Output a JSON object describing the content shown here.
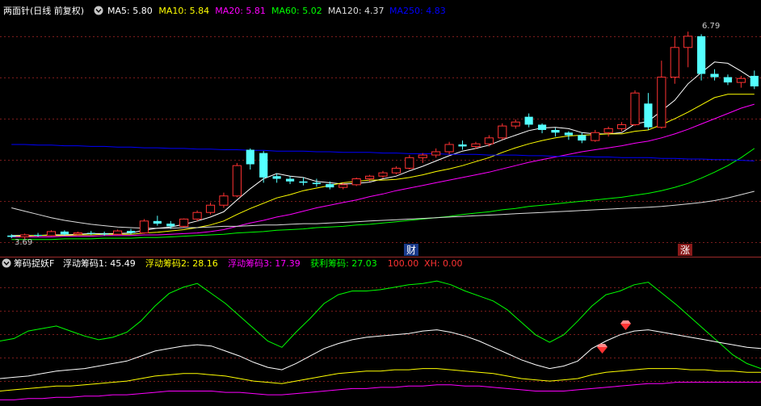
{
  "top_panel": {
    "title": "两面针(日线 前复权)",
    "ma_labels": [
      {
        "text": "MA5: 5.80",
        "color": "#ffffff"
      },
      {
        "text": "MA10: 5.84",
        "color": "#ffff00"
      },
      {
        "text": "MA20: 5.81",
        "color": "#ff00ff"
      },
      {
        "text": "MA60: 5.02",
        "color": "#00ff00"
      },
      {
        "text": "MA120: 4.37",
        "color": "#dddddd"
      },
      {
        "text": "MA250: 4.83",
        "color": "#0000ff"
      }
    ],
    "high_label": "6.79",
    "low_label": "3.69",
    "markers": [
      "财",
      "涨"
    ]
  },
  "bottom_panel": {
    "title": "筹码捉妖F",
    "labels": [
      {
        "text": "浮动筹码1: 45.49",
        "color": "#ffffff"
      },
      {
        "text": "浮动筹码2: 28.16",
        "color": "#ffff00"
      },
      {
        "text": "浮动筹码3: 17.39",
        "color": "#ff00ff"
      },
      {
        "text": "获利筹码: 27.03",
        "color": "#00ff00"
      },
      {
        "text": "100.00",
        "color": "#ff3333"
      },
      {
        "text": "XH: 0.00",
        "color": "#ff3333"
      }
    ]
  },
  "chart_data": [
    {
      "type": "candlestick",
      "title": "两面针(日线 前复权)",
      "ylim": [
        3.6,
        7.0
      ],
      "log_scale": false,
      "up_color": "#ff3232",
      "down_color": "#54ffff",
      "candles": [
        [
          3.7,
          3.72,
          3.66,
          3.68
        ],
        [
          3.68,
          3.73,
          3.65,
          3.71
        ],
        [
          3.71,
          3.74,
          3.68,
          3.7
        ],
        [
          3.7,
          3.78,
          3.69,
          3.76
        ],
        [
          3.76,
          3.78,
          3.7,
          3.72
        ],
        [
          3.72,
          3.76,
          3.7,
          3.74
        ],
        [
          3.74,
          3.77,
          3.71,
          3.73
        ],
        [
          3.73,
          3.76,
          3.7,
          3.72
        ],
        [
          3.72,
          3.79,
          3.71,
          3.77
        ],
        [
          3.77,
          3.8,
          3.72,
          3.74
        ],
        [
          3.74,
          3.95,
          3.73,
          3.92
        ],
        [
          3.92,
          4.0,
          3.85,
          3.88
        ],
        [
          3.88,
          3.92,
          3.8,
          3.84
        ],
        [
          3.84,
          3.96,
          3.82,
          3.95
        ],
        [
          3.95,
          4.08,
          3.92,
          4.05
        ],
        [
          4.05,
          4.2,
          4.02,
          4.16
        ],
        [
          4.16,
          4.35,
          4.12,
          4.3
        ],
        [
          4.3,
          4.8,
          4.28,
          4.76
        ],
        [
          5.0,
          5.02,
          4.7,
          4.78
        ],
        [
          4.95,
          4.98,
          4.5,
          4.58
        ],
        [
          4.6,
          4.64,
          4.5,
          4.56
        ],
        [
          4.56,
          4.6,
          4.48,
          4.52
        ],
        [
          4.52,
          4.58,
          4.46,
          4.5
        ],
        [
          4.5,
          4.56,
          4.44,
          4.48
        ],
        [
          4.48,
          4.52,
          4.4,
          4.43
        ],
        [
          4.43,
          4.5,
          4.4,
          4.47
        ],
        [
          4.47,
          4.58,
          4.45,
          4.56
        ],
        [
          4.56,
          4.62,
          4.52,
          4.6
        ],
        [
          4.6,
          4.68,
          4.57,
          4.65
        ],
        [
          4.65,
          4.75,
          4.63,
          4.72
        ],
        [
          4.72,
          4.92,
          4.7,
          4.88
        ],
        [
          4.88,
          4.95,
          4.8,
          4.92
        ],
        [
          4.92,
          5.02,
          4.88,
          4.97
        ],
        [
          4.97,
          5.12,
          4.93,
          5.08
        ],
        [
          5.08,
          5.14,
          5.0,
          5.05
        ],
        [
          5.05,
          5.12,
          5.01,
          5.09
        ],
        [
          5.09,
          5.22,
          5.05,
          5.18
        ],
        [
          5.18,
          5.4,
          5.15,
          5.36
        ],
        [
          5.36,
          5.46,
          5.32,
          5.42
        ],
        [
          5.5,
          5.55,
          5.34,
          5.38
        ],
        [
          5.38,
          5.4,
          5.25,
          5.3
        ],
        [
          5.3,
          5.33,
          5.2,
          5.26
        ],
        [
          5.26,
          5.28,
          5.15,
          5.22
        ],
        [
          5.22,
          5.26,
          5.1,
          5.14
        ],
        [
          5.14,
          5.3,
          5.12,
          5.26
        ],
        [
          5.26,
          5.35,
          5.2,
          5.32
        ],
        [
          5.32,
          5.42,
          5.28,
          5.38
        ],
        [
          5.38,
          5.9,
          5.36,
          5.86
        ],
        [
          5.7,
          5.86,
          5.3,
          5.34
        ],
        [
          5.34,
          6.35,
          5.32,
          6.1
        ],
        [
          6.1,
          6.72,
          6.0,
          6.55
        ],
        [
          6.55,
          6.79,
          6.25,
          6.72
        ],
        [
          6.72,
          6.75,
          6.05,
          6.15
        ],
        [
          6.15,
          6.22,
          6.05,
          6.1
        ],
        [
          6.1,
          6.14,
          5.98,
          6.02
        ],
        [
          6.02,
          6.12,
          5.94,
          6.08
        ],
        [
          6.12,
          6.2,
          5.92,
          5.96
        ]
      ],
      "ma_series": [
        {
          "name": "MA5",
          "color": "#ffffff",
          "values": [
            3.7,
            3.7,
            3.7,
            3.71,
            3.71,
            3.72,
            3.73,
            3.73,
            3.73,
            3.74,
            3.78,
            3.81,
            3.83,
            3.87,
            3.92,
            3.98,
            4.06,
            4.24,
            4.41,
            4.56,
            4.64,
            4.6,
            4.58,
            4.52,
            4.5,
            4.48,
            4.49,
            4.51,
            4.56,
            4.6,
            4.68,
            4.75,
            4.83,
            4.91,
            4.98,
            5.02,
            5.07,
            5.15,
            5.22,
            5.29,
            5.33,
            5.34,
            5.32,
            5.26,
            5.24,
            5.24,
            5.26,
            5.39,
            5.43,
            5.59,
            5.75,
            6.0,
            6.17,
            6.33,
            6.31,
            6.19,
            6.06
          ]
        },
        {
          "name": "MA10",
          "color": "#ffff00",
          "values": [
            3.69,
            3.69,
            3.7,
            3.7,
            3.7,
            3.71,
            3.71,
            3.72,
            3.72,
            3.72,
            3.74,
            3.75,
            3.77,
            3.79,
            3.82,
            3.86,
            3.92,
            4.02,
            4.11,
            4.19,
            4.27,
            4.32,
            4.38,
            4.42,
            4.46,
            4.5,
            4.52,
            4.54,
            4.54,
            4.55,
            4.58,
            4.62,
            4.67,
            4.71,
            4.76,
            4.82,
            4.88,
            4.96,
            5.03,
            5.09,
            5.14,
            5.18,
            5.21,
            5.22,
            5.23,
            5.24,
            5.24,
            5.28,
            5.3,
            5.38,
            5.47,
            5.57,
            5.68,
            5.79,
            5.84,
            5.84,
            5.84
          ]
        },
        {
          "name": "MA20",
          "color": "#ff00ff",
          "values": [
            3.68,
            3.68,
            3.68,
            3.68,
            3.69,
            3.69,
            3.69,
            3.7,
            3.7,
            3.7,
            3.71,
            3.71,
            3.72,
            3.73,
            3.74,
            3.76,
            3.79,
            3.84,
            3.89,
            3.93,
            3.98,
            4.02,
            4.07,
            4.12,
            4.16,
            4.2,
            4.24,
            4.29,
            4.33,
            4.38,
            4.42,
            4.46,
            4.5,
            4.54,
            4.58,
            4.62,
            4.66,
            4.71,
            4.76,
            4.81,
            4.85,
            4.89,
            4.93,
            4.97,
            5.0,
            5.03,
            5.06,
            5.1,
            5.13,
            5.18,
            5.24,
            5.31,
            5.39,
            5.47,
            5.55,
            5.63,
            5.69
          ]
        },
        {
          "name": "MA60",
          "color": "#00ff00",
          "values": [
            3.64,
            3.64,
            3.64,
            3.64,
            3.65,
            3.65,
            3.65,
            3.66,
            3.66,
            3.66,
            3.67,
            3.67,
            3.68,
            3.69,
            3.7,
            3.71,
            3.72,
            3.74,
            3.75,
            3.76,
            3.78,
            3.79,
            3.8,
            3.82,
            3.83,
            3.84,
            3.86,
            3.87,
            3.89,
            3.91,
            3.93,
            3.95,
            3.97,
            3.99,
            4.02,
            4.04,
            4.06,
            4.09,
            4.11,
            4.14,
            4.16,
            4.18,
            4.2,
            4.22,
            4.24,
            4.26,
            4.28,
            4.31,
            4.34,
            4.38,
            4.43,
            4.49,
            4.57,
            4.66,
            4.76,
            4.88,
            5.02
          ]
        },
        {
          "name": "MA120",
          "color": "#dddddd",
          "values": [
            4.12,
            4.07,
            4.02,
            3.97,
            3.93,
            3.9,
            3.87,
            3.85,
            3.83,
            3.82,
            3.81,
            3.81,
            3.81,
            3.82,
            3.82,
            3.83,
            3.84,
            3.84,
            3.85,
            3.86,
            3.86,
            3.87,
            3.88,
            3.88,
            3.89,
            3.9,
            3.91,
            3.92,
            3.93,
            3.94,
            3.95,
            3.96,
            3.97,
            3.98,
            3.99,
            4.0,
            4.01,
            4.02,
            4.03,
            4.04,
            4.05,
            4.06,
            4.07,
            4.08,
            4.09,
            4.1,
            4.11,
            4.12,
            4.13,
            4.14,
            4.16,
            4.18,
            4.2,
            4.23,
            4.27,
            4.32,
            4.37
          ]
        },
        {
          "name": "MA250",
          "color": "#0000ff",
          "values": [
            5.08,
            5.08,
            5.07,
            5.07,
            5.06,
            5.06,
            5.05,
            5.05,
            5.04,
            5.04,
            5.03,
            5.03,
            5.02,
            5.02,
            5.01,
            5.01,
            5.0,
            5.0,
            4.99,
            4.99,
            4.98,
            4.98,
            4.98,
            4.97,
            4.97,
            4.96,
            4.96,
            4.96,
            4.95,
            4.95,
            4.94,
            4.94,
            4.94,
            4.93,
            4.93,
            4.93,
            4.92,
            4.92,
            4.92,
            4.91,
            4.91,
            4.9,
            4.9,
            4.9,
            4.89,
            4.89,
            4.88,
            4.88,
            4.88,
            4.87,
            4.87,
            4.86,
            4.86,
            4.85,
            4.85,
            4.84,
            4.83
          ]
        }
      ]
    },
    {
      "type": "line",
      "title": "筹码捉妖F",
      "ylim": [
        0,
        100
      ],
      "grid": true,
      "reference_value": 100.0,
      "series": [
        {
          "name": "获利筹码",
          "color": "#00ff00",
          "values": [
            50,
            52,
            58,
            60,
            62,
            58,
            54,
            51,
            53,
            57,
            66,
            78,
            88,
            93,
            96,
            88,
            80,
            70,
            60,
            50,
            45,
            57,
            68,
            80,
            87,
            90,
            90,
            91,
            93,
            95,
            96,
            98,
            95,
            90,
            86,
            82,
            75,
            65,
            55,
            49,
            55,
            66,
            78,
            87,
            90,
            95,
            97,
            88,
            79,
            69,
            59,
            49,
            39,
            32,
            28
          ]
        },
        {
          "name": "浮动筹码1",
          "color": "#ffffff",
          "values": [
            20,
            21,
            22,
            24,
            26,
            27,
            28,
            30,
            32,
            34,
            38,
            42,
            44,
            46,
            47,
            46,
            42,
            38,
            33,
            29,
            27,
            32,
            38,
            44,
            48,
            51,
            53,
            54,
            55,
            56,
            58,
            59,
            57,
            54,
            50,
            45,
            40,
            35,
            31,
            28,
            30,
            34,
            44,
            50,
            55,
            58,
            59,
            57,
            55,
            53,
            51,
            49,
            47,
            45,
            44
          ]
        },
        {
          "name": "浮动筹码2",
          "color": "#ffff00",
          "values": [
            10,
            11,
            12,
            13,
            14,
            14,
            15,
            16,
            17,
            18,
            20,
            22,
            23,
            24,
            24,
            23,
            22,
            20,
            18,
            17,
            16,
            18,
            20,
            22,
            24,
            25,
            26,
            26,
            27,
            27,
            28,
            28,
            27,
            26,
            25,
            24,
            22,
            20,
            19,
            18,
            19,
            20,
            23,
            25,
            26,
            27,
            28,
            28,
            28,
            27,
            27,
            26,
            26,
            25,
            25
          ]
        },
        {
          "name": "浮动筹码3",
          "color": "#ff00ff",
          "values": [
            3,
            3,
            4,
            4,
            5,
            5,
            6,
            6,
            7,
            7,
            8,
            9,
            10,
            10,
            10,
            10,
            9,
            9,
            8,
            7,
            7,
            8,
            9,
            10,
            11,
            12,
            12,
            13,
            13,
            14,
            14,
            15,
            15,
            14,
            14,
            13,
            12,
            11,
            10,
            10,
            10,
            11,
            12,
            13,
            14,
            15,
            16,
            16,
            17,
            17,
            17,
            17,
            17,
            17,
            17
          ]
        }
      ]
    }
  ]
}
